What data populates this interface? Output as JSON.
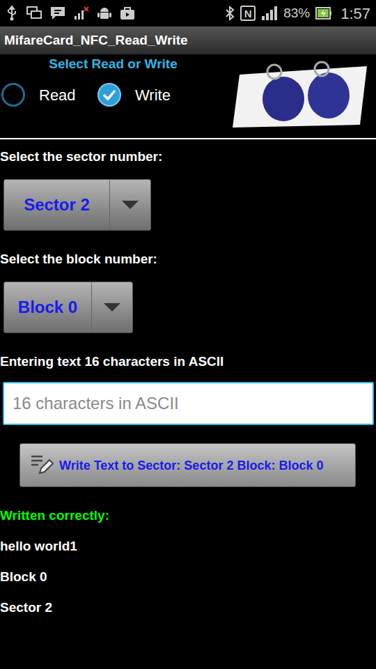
{
  "status_bar": {
    "nfc": "N",
    "battery": "83%",
    "time": "1:57"
  },
  "app_title": "MifareCard_NFC_Read_Write",
  "mode": {
    "label": "Select Read or Write",
    "options": [
      {
        "label": "Read",
        "selected": false
      },
      {
        "label": "Write",
        "selected": true
      }
    ]
  },
  "sector": {
    "label": "Select the sector number:",
    "value": "Sector 2"
  },
  "block": {
    "label": "Select the block number:",
    "value": "Block 0"
  },
  "text_input": {
    "label": "Entering text 16 characters in ASCII",
    "placeholder": "16 characters in ASCII"
  },
  "write_button": "Write Text to Sector: Sector 2 Block: Block 0",
  "result": {
    "title": "Written correctly:",
    "lines": [
      "hello world1",
      "Block 0",
      "Sector 2"
    ]
  }
}
